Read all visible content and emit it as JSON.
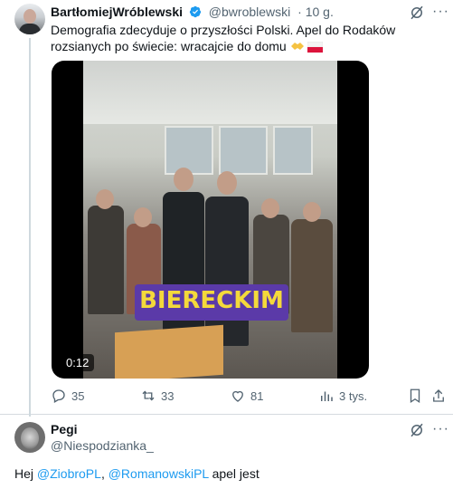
{
  "tweet": {
    "author_name": "BartłomiejWróblewski",
    "author_handle": "@bwroblewski",
    "time": "· 10 g.",
    "text": "Demografia zdecyduje o przyszłości Polski. Apel do Rodaków rozsianych po świecie: wracajcie do domu",
    "emojis": [
      "handshake",
      "poland-flag"
    ],
    "video": {
      "caption": "BIERECKIM",
      "duration": "0:12"
    },
    "actions": {
      "replies": "35",
      "reposts": "33",
      "likes": "81",
      "views": "3 tys."
    }
  },
  "reply": {
    "author_name": "Pegi",
    "author_handle": "@Niespodzianka_",
    "text_prefix": "Hej ",
    "mention1": "@ZiobroPL",
    "text_sep": ", ",
    "mention2": "@RomanowskiPL",
    "text_suffix": " apel jest"
  },
  "colors": {
    "accent": "#1d9bf0",
    "secondary_text": "#536471",
    "caption_bg": "#5b3aa8",
    "caption_text": "#f4d93b"
  }
}
